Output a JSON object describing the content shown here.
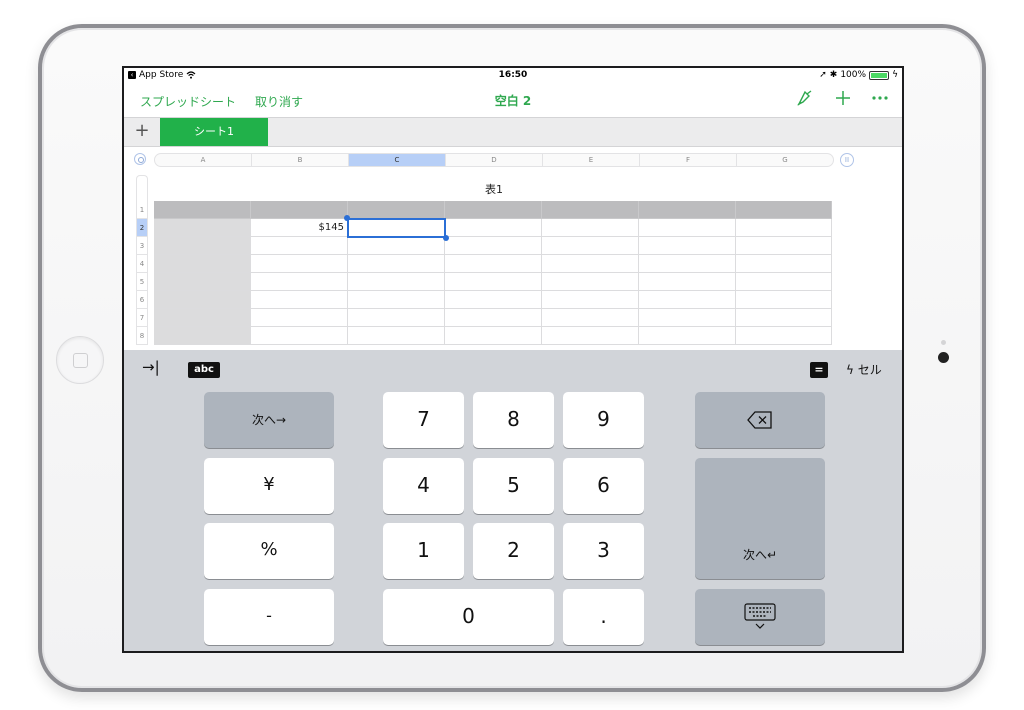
{
  "status_bar": {
    "back_app": "App Store",
    "time": "16:50",
    "battery": "100%"
  },
  "nav": {
    "spreadsheets_link": "スプレッドシート",
    "undo_link": "取り消す",
    "title": "空白 2"
  },
  "sheet_tabs": {
    "add": "+",
    "active": "シート1"
  },
  "columns": [
    "A",
    "B",
    "C",
    "D",
    "E",
    "F",
    "G"
  ],
  "selected_column": "C",
  "pause_glyph": "II",
  "table": {
    "title": "表1",
    "rows": [
      "1",
      "2",
      "3",
      "4",
      "5",
      "6",
      "7",
      "8"
    ],
    "selected_row": "2",
    "b2_value": "$145"
  },
  "keyboard": {
    "toolbar": {
      "tab_symbol": "→|",
      "abc": "abc",
      "equals": "=",
      "cell_label": "セル"
    },
    "next_arrow": "次へ→",
    "yen": "¥",
    "percent": "%",
    "minus": "-",
    "digits": [
      "7",
      "8",
      "9",
      "4",
      "5",
      "6",
      "1",
      "2",
      "3",
      "0"
    ],
    "dot": ".",
    "next_return": "次へ↵"
  },
  "colors": {
    "accent_green": "#2fa84f",
    "tab_green": "#21b14a",
    "selection_blue": "#2b6fd6",
    "keyboard_bg": "#d1d4d9"
  },
  "icons": [
    "app-back-icon",
    "wifi-icon",
    "location-icon",
    "bluetooth-icon",
    "battery-icon",
    "format-brush-icon",
    "add-icon",
    "more-icon",
    "tab-key-icon",
    "lightning-icon",
    "delete-key-icon",
    "hide-keyboard-icon"
  ]
}
